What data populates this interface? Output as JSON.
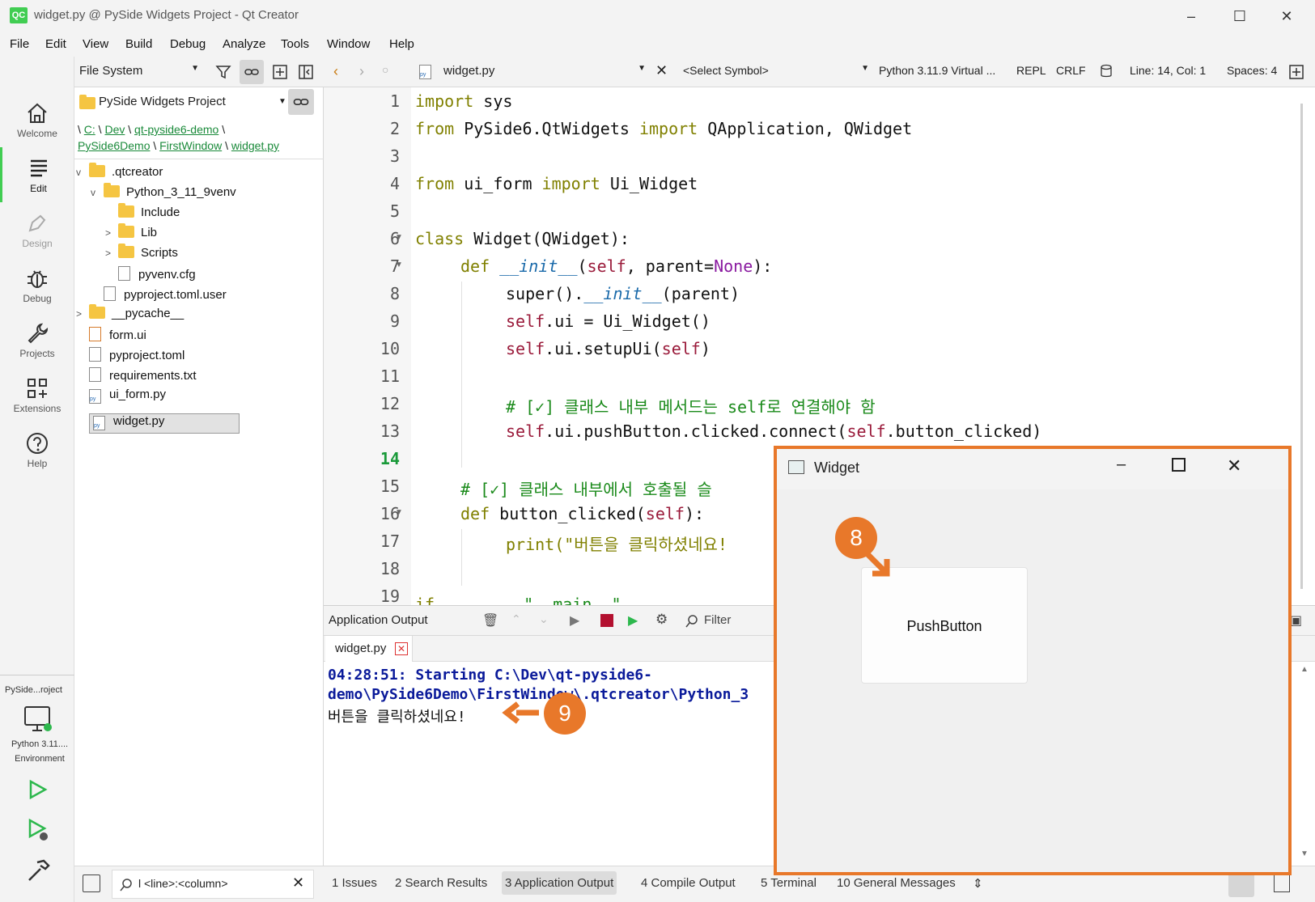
{
  "window": {
    "logo": "QC",
    "title": "widget.py @ PySide Widgets Project - Qt Creator"
  },
  "menu": [
    "File",
    "Edit",
    "View",
    "Build",
    "Debug",
    "Analyze",
    "Tools",
    "Window",
    "Help"
  ],
  "modes": [
    {
      "label": "Welcome",
      "icon": "home-icon"
    },
    {
      "label": "Edit",
      "icon": "edit-lines-icon"
    },
    {
      "label": "Design",
      "icon": "pen-icon"
    },
    {
      "label": "Debug",
      "icon": "bug-icon"
    },
    {
      "label": "Projects",
      "icon": "wrench-icon"
    },
    {
      "label": "Extensions",
      "icon": "extensions-icon"
    },
    {
      "label": "Help",
      "icon": "help-icon"
    }
  ],
  "kit": {
    "project": "PySide...roject",
    "env_line1": "Python 3.11....",
    "env_line2": "Environment"
  },
  "sidebar": {
    "view_combo": "File System",
    "project_combo": "PySide Widgets Project",
    "breadcrumb": {
      "c": "C:",
      "dev": "Dev",
      "demo": "qt-pyside6-demo",
      "pyside": "PySide6Demo",
      "firstwindow": "FirstWindow",
      "file": "widget.py",
      "sep": "\\"
    },
    "tree": [
      {
        "name": ".qtcreator",
        "type": "folder",
        "expand": "v"
      },
      {
        "name": "Python_3_11_9venv",
        "type": "folder",
        "expand": "v"
      },
      {
        "name": "Include",
        "type": "folder",
        "expand": ""
      },
      {
        "name": "Lib",
        "type": "folder",
        "expand": ">"
      },
      {
        "name": "Scripts",
        "type": "folder",
        "expand": ">"
      },
      {
        "name": "pyvenv.cfg",
        "type": "file",
        "expand": ""
      },
      {
        "name": "pyproject.toml.user",
        "type": "file",
        "expand": ""
      },
      {
        "name": "__pycache__",
        "type": "folder",
        "expand": ">"
      },
      {
        "name": "form.ui",
        "type": "file",
        "expand": ""
      },
      {
        "name": "pyproject.toml",
        "type": "file",
        "expand": ""
      },
      {
        "name": "requirements.txt",
        "type": "file",
        "expand": ""
      },
      {
        "name": "ui_form.py",
        "type": "file",
        "expand": ""
      },
      {
        "name": "widget.py",
        "type": "file",
        "expand": "",
        "selected": true
      }
    ]
  },
  "editor_toolbar": {
    "file": "widget.py",
    "symbol": "<Select Symbol>",
    "interpreter": "Python 3.11.9 Virtual ...",
    "repl": "REPL",
    "eol": "CRLF",
    "position": "Line: 14, Col: 1",
    "spaces": "Spaces: 4"
  },
  "code": {
    "current_line": 14,
    "lines": [
      "1",
      "2",
      "3",
      "4",
      "5",
      "6",
      "7",
      "8",
      "9",
      "10",
      "11",
      "12",
      "13",
      "14",
      "15",
      "16",
      "17",
      "18",
      "19"
    ],
    "t": {
      "import": "import",
      "sys": " sys",
      "from": "from",
      "pyside_mod": " PySide6.QtWidgets ",
      "qapp": " QApplication, QWidget",
      "uiform_mod": " ui_form ",
      "uiwidget": " Ui_Widget",
      "class": "class",
      "class_sig": " Widget(QWidget):",
      "def": "def",
      "init": "__init__",
      "paren_open": "(",
      "self": "self",
      "parent_sig": ", parent=",
      "none": "None",
      "close_colon": "):",
      "super": "super().",
      "parent_call": "(parent)",
      "ui_assign": ".ui = Ui_Widget()",
      "setup": ".ui.setupUi(",
      "close_paren": ")",
      "comment1": "# [✓] 클래스 내부 메서드는 self로 연결해야 함",
      "connect": ".ui.pushButton.clicked.connect(",
      "connect_tail": ".button_clicked)",
      "comment2": "# [✓] 클래스 내부에서 호출될 슬",
      "btn_sig": " button_clicked(",
      "print": "print(\"버튼을 클릭하셨네요!",
      "if_partial": "if",
      "main_partial": "\"__main__\""
    }
  },
  "output": {
    "panel_title": "Application Output",
    "filter": "Filter",
    "tab": "widget.py",
    "line1": "04:28:51: Starting C:\\Dev\\qt-pyside6-",
    "line2": "demo\\PySide6Demo\\FirstWindow\\.qtcreator\\Python_3",
    "line3": "버튼을 클릭하셨네요!"
  },
  "bottom": {
    "locator": "l <line>:<column>",
    "tabs": [
      "1  Issues",
      "2  Search Results",
      "3  Application Output",
      "4  Compile Output",
      "5  Terminal",
      "10  General Messages"
    ]
  },
  "widget_window": {
    "title": "Widget",
    "button": "PushButton"
  },
  "annotations": {
    "step8": "8",
    "step9": "9",
    "accent": "#e8782a"
  }
}
